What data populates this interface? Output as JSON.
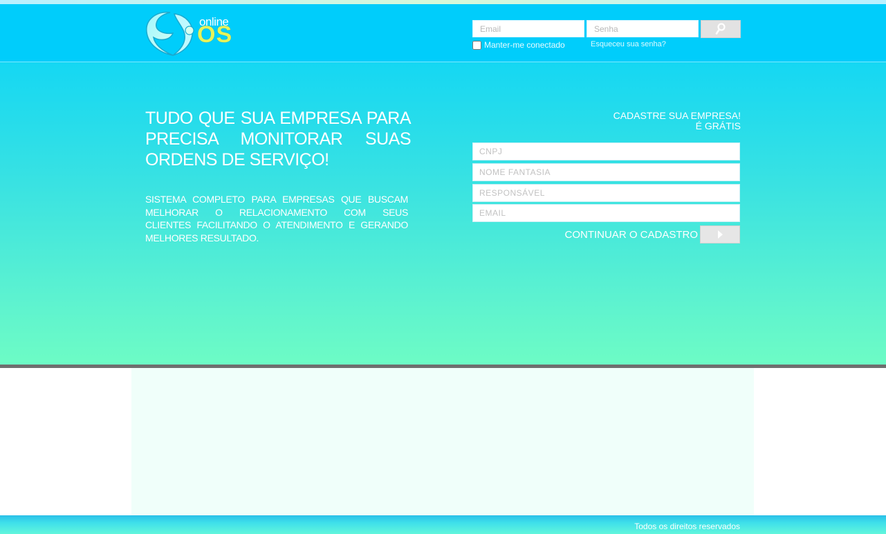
{
  "brand": {
    "logo_online": "online",
    "logo_os": "OS"
  },
  "login": {
    "email_placeholder": "Email",
    "password_placeholder": "Senha",
    "submit_icon": "search-icon",
    "remember_label": "Manter-me conectado",
    "remember_checked": false,
    "forgot_label": "Esqueceu sua senha?"
  },
  "hero": {
    "headline_lines": [
      "TUDO QUE SUA EMPRESA PARA",
      "PRECISA MONITORAR SUAS",
      "ORDENS DE SERVIÇO!"
    ],
    "description_lines": [
      "SISTEMA COMPLETO PARA EMPRESAS QUE BUSCAM",
      "MELHORAR O RELACIONAMENTO COM SEUS",
      "CLIENTES FACILITANDO O ATENDIMENTO E GERANDO",
      "MELHORES RESULTADO."
    ]
  },
  "register": {
    "title_line1": "CADASTRE SUA EMPRESA!",
    "title_line2": "É GRÁTIS",
    "cnpj_placeholder": "CNPJ",
    "company_placeholder": "NOME FANTASIA",
    "responsible_placeholder": "RESPONSÁVEL",
    "email_placeholder": "EMAIL",
    "continue_label": "CONTINUAR O CADASTRO",
    "continue_icon": "play-arrow-icon"
  },
  "footer": {
    "copyright": "Todos os direitos reservados"
  },
  "colors": {
    "header_bg": "#00cdfb",
    "hero_top": "#15d7f3",
    "hero_bottom": "#6dfcc5",
    "logo_accent": "#e6f35a",
    "divider": "#6f6f6f"
  }
}
